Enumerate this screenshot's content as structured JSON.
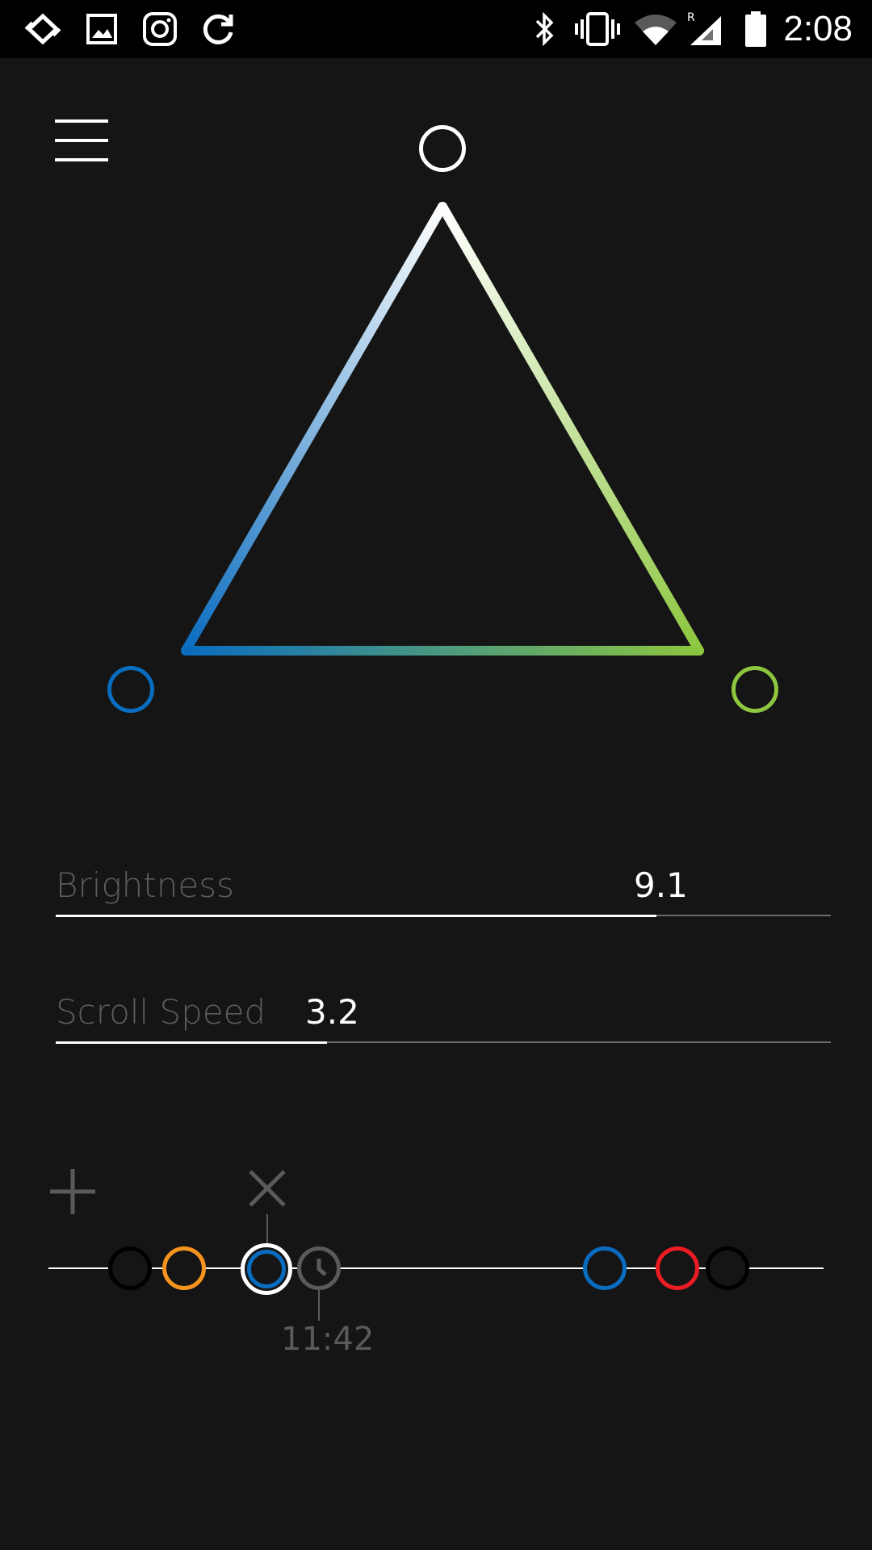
{
  "status_bar": {
    "time": "2:08",
    "left_icons": [
      "sync-arrows-icon",
      "image-icon",
      "instagram-icon",
      "refresh-icon"
    ],
    "right_icons": [
      "bluetooth-icon",
      "vibrate-icon",
      "wifi-icon",
      "cellular-roaming-icon",
      "battery-icon"
    ],
    "roaming_indicator": "R"
  },
  "colors": {
    "background": "#151515",
    "top_vertex": "#ffffff",
    "left_vertex": "#0a6cbf",
    "right_vertex": "#8dc63f",
    "node_orange": "#f7941d",
    "node_blue": "#0a6cbf",
    "node_red": "#ed1c24",
    "node_black": "#000000"
  },
  "controls": {
    "brightness": {
      "label": "Brightness",
      "value": "9.1",
      "fraction": 0.775
    },
    "scroll_speed": {
      "label": "Scroll Speed",
      "value": "3.2",
      "fraction": 0.35
    }
  },
  "timeline": {
    "selected_time": "11:42",
    "nodes": [
      "black",
      "orange",
      "blue-selected",
      "clock",
      "blue",
      "red",
      "black"
    ]
  }
}
